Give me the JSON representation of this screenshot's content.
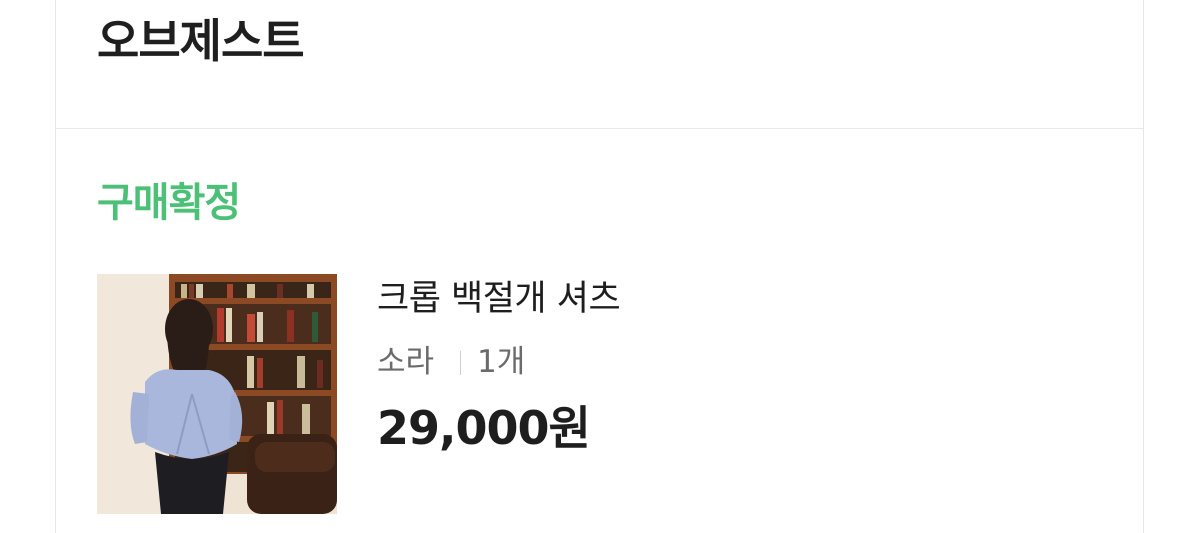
{
  "store": {
    "name": "오브제스트"
  },
  "order": {
    "status": "구매확정",
    "status_color": "#4cc076",
    "item": {
      "name": "크롭 백절개 셔츠",
      "option_color": "소라",
      "quantity": "1개",
      "price": "29,000원",
      "thumbnail_icon": "product-photo-shirt"
    }
  }
}
